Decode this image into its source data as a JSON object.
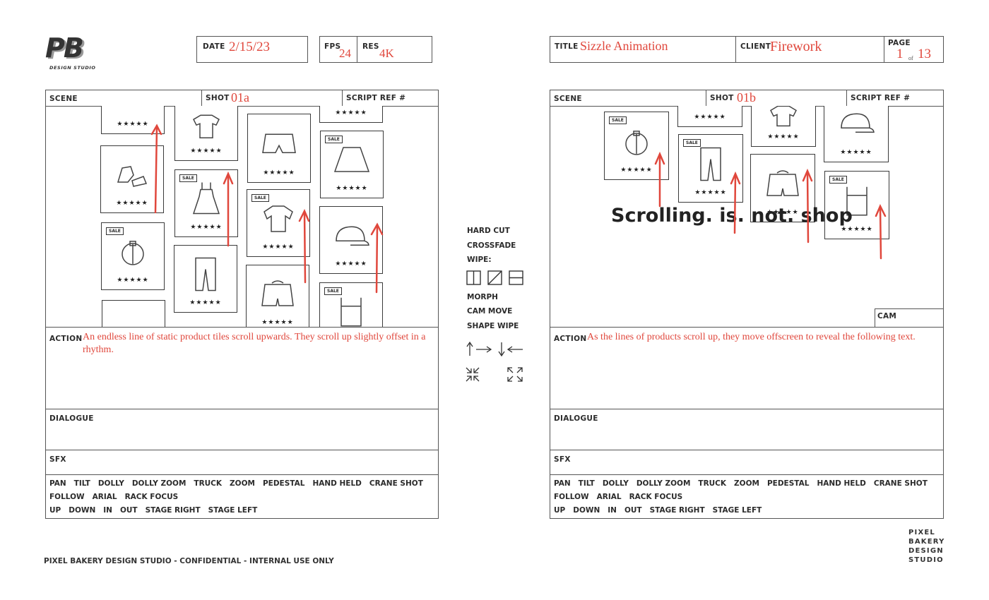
{
  "logo": {
    "mark": "PB",
    "subtitle": "DESIGN STUDIO"
  },
  "header_left": {
    "date_label": "DATE",
    "date_value": "2/15/23",
    "fps_label": "FPS",
    "fps_value": "24",
    "res_label": "RES",
    "res_value": "4K"
  },
  "header_right": {
    "title_label": "TITLE",
    "title_value": "Sizzle Animation",
    "client_label": "CLIENT",
    "client_value": "Firework",
    "page_label": "PAGE",
    "page_current": "1",
    "page_of": "of",
    "page_total": "13"
  },
  "panels": [
    {
      "scene_label": "SCENE",
      "shot_label": "SHOT",
      "shot_value": "01a",
      "script_ref_label": "SCRIPT REF #",
      "action_label": "ACTION",
      "action_text": "An endless line of static product tiles scroll upwards. They scroll up slightly offset in a rhythm.",
      "dialogue_label": "DIALOGUE",
      "sfx_label": "SFX"
    },
    {
      "scene_label": "SCENE",
      "shot_label": "SHOT",
      "shot_value": "01b",
      "script_ref_label": "SCRIPT REF #",
      "cam_label": "CAM",
      "overlay_text": "Scrolling. is. not. shop",
      "action_label": "ACTION",
      "action_text": "As the lines of products scroll up, they move offscreen to reveal the following text.",
      "dialogue_label": "DIALOGUE",
      "sfx_label": "SFX"
    }
  ],
  "tile": {
    "stars": "★★★★★",
    "sale": "SALE"
  },
  "camera_moves": {
    "row1": [
      "PAN",
      "TILT",
      "DOLLY",
      "DOLLY ZOOM",
      "TRUCK",
      "ZOOM",
      "PEDESTAL",
      "HAND HELD",
      "CRANE SHOT"
    ],
    "row2": [
      "FOLLOW",
      "ARIAL",
      "RACK FOCUS"
    ],
    "row3": [
      "UP",
      "DOWN",
      "IN",
      "OUT",
      "STAGE RIGHT",
      "STAGE LEFT"
    ]
  },
  "transitions": {
    "hard_cut": "HARD CUT",
    "crossfade": "CROSSFADE",
    "wipe": "WIPE:",
    "morph": "MORPH",
    "cam_move": "CAM MOVE",
    "shape_wipe": "SHAPE WIPE"
  },
  "footer": {
    "confidential": "PIXEL BAKERY DESIGN STUDIO - CONFIDENTIAL - INTERNAL USE ONLY",
    "studio_lines": [
      "PIXEL",
      "BAKERY",
      "DESIGN",
      "STUDIO"
    ]
  },
  "colors": {
    "ink": "#2a2a2a",
    "red": "#e0473c",
    "border": "#555555"
  }
}
